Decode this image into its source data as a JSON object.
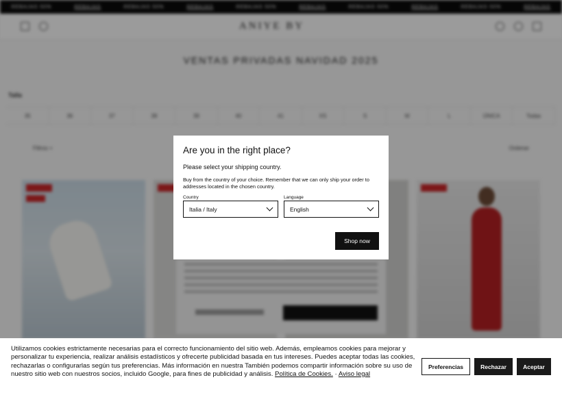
{
  "promo": {
    "items": [
      "REBAJAS 50%",
      "REBAJAS",
      "REBAJAS 50%",
      "REBAJAS",
      "REBAJAS 50%",
      "REBAJAS",
      "REBAJAS 50%",
      "REBAJAS",
      "REBAJAS 50%",
      "REBAJAS"
    ]
  },
  "header": {
    "logo": "ANIYE BY"
  },
  "page": {
    "title": "VENTAS PRIVADAS NAVIDAD 2025",
    "size_label": "Talla",
    "sizes": [
      "35",
      "36",
      "37",
      "38",
      "39",
      "40",
      "41",
      "XS",
      "S",
      "M",
      "L",
      "ÚNICA",
      "Todas"
    ],
    "filter_label": "Filtros +",
    "sort_label": "Ordenar"
  },
  "modal": {
    "title": "Are you in the right place?",
    "subtitle": "Please select your shipping country.",
    "note": "Buy from the country of your choice. Remember that we can only ship your order to addresses located in the chosen country.",
    "country_label": "Country",
    "country_value": "Italia / Italy",
    "language_label": "Language",
    "language_value": "English",
    "shop_button": "Shop now"
  },
  "cookie": {
    "text": "Utilizamos cookies estrictamente necesarias para el correcto funcionamiento del sitio web. Además, empleamos cookies para mejorar y personalizar tu experiencia, realizar análisis estadísticos y ofrecerte publicidad basada en tus intereses. Puedes aceptar todas las cookies, rechazarlas o configurarlas según tus preferencias. Más información en nuestra También podemos compartir información sobre su uso de nuestro sitio web con nuestros socios, incluido Google, para fines de publicidad y análisis.",
    "policy_link": "Política de Cookies.",
    "separator": " · ",
    "legal_link": "Aviso legal",
    "preferences_button": "Preferencias",
    "reject_button": "Rechazar",
    "accept_button": "Aceptar"
  },
  "colors": {
    "overlay": "#000000",
    "sale_red": "#c9272a",
    "button_dark": "#111111"
  }
}
